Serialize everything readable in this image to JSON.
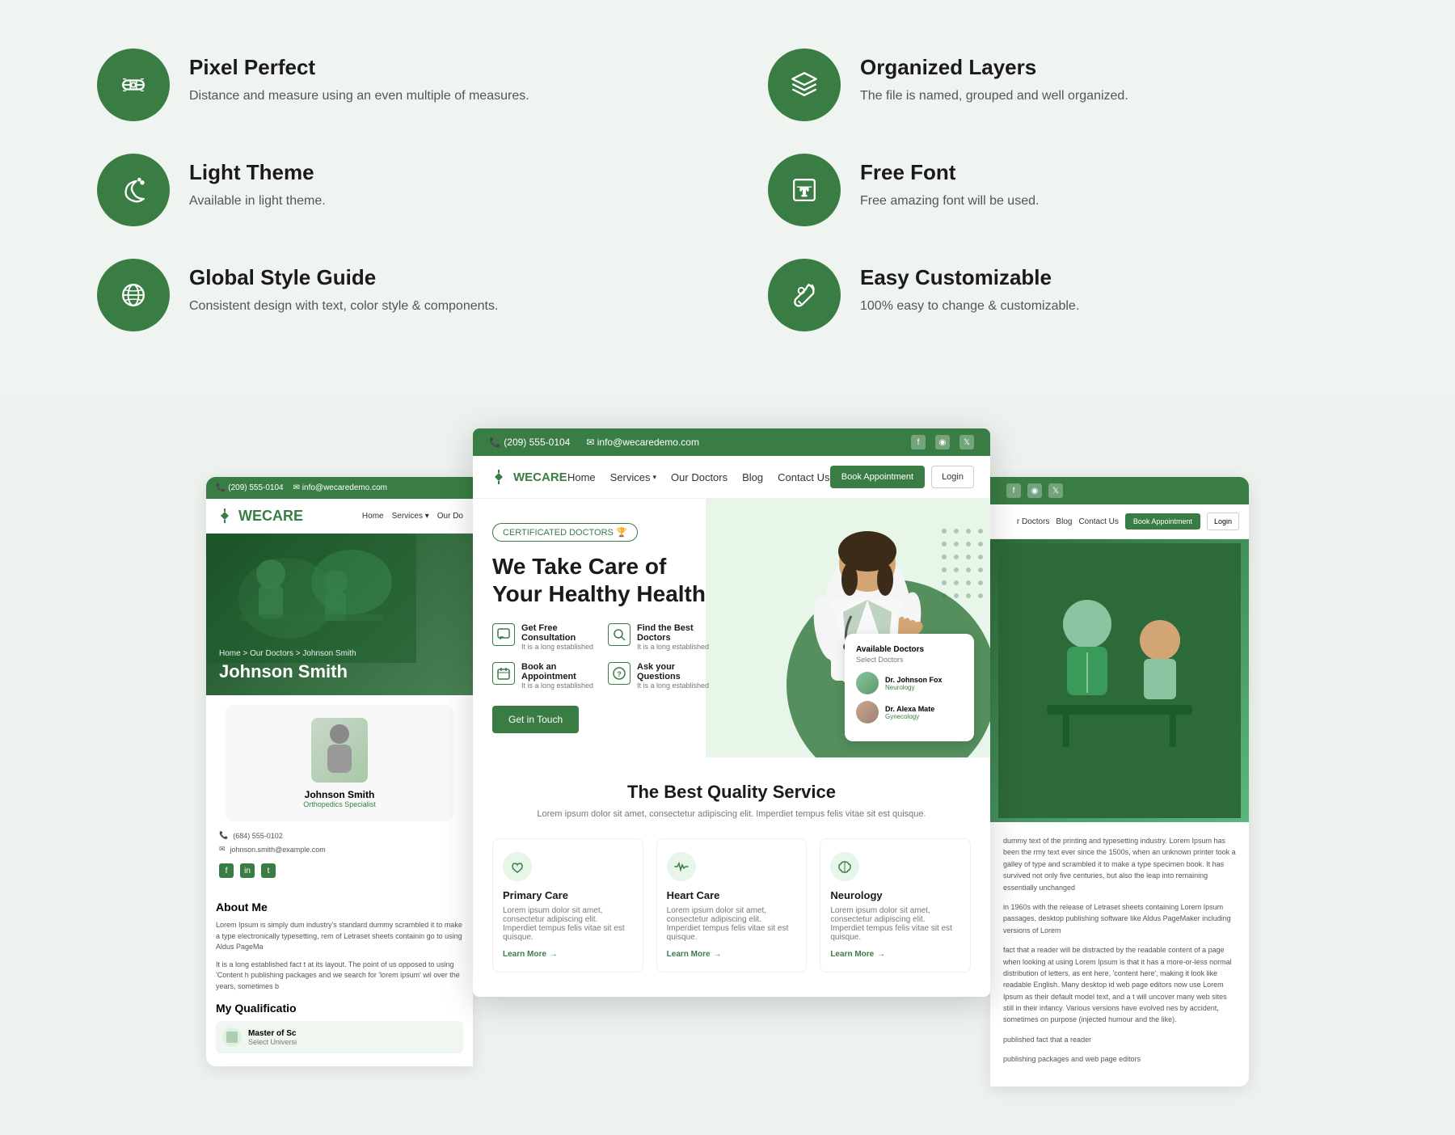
{
  "features": [
    {
      "id": "pixel-perfect",
      "title": "Pixel Perfect",
      "description": "Distance and measure using an even multiple of measures.",
      "icon": "bandage"
    },
    {
      "id": "organized-layers",
      "title": "Organized Layers",
      "description": "The file is named, grouped and well organized.",
      "icon": "layers"
    },
    {
      "id": "light-theme",
      "title": "Light Theme",
      "description": "Available in light theme.",
      "icon": "moon"
    },
    {
      "id": "free-font",
      "title": "Free Font",
      "description": "Free amazing font will be used.",
      "icon": "text"
    },
    {
      "id": "global-style",
      "title": "Global Style Guide",
      "description": "Consistent design with text, color style & components.",
      "icon": "globe"
    },
    {
      "id": "easy-custom",
      "title": "Easy Customizable",
      "description": "100% easy to change & customizable.",
      "icon": "wrench"
    }
  ],
  "topbar": {
    "phone": "(209) 555-0104",
    "email": "info@wecaredemo.com"
  },
  "nav": {
    "logo": "WECARE",
    "links": [
      "Home",
      "Services",
      "Our Doctors",
      "Blog",
      "Contact Us"
    ],
    "book_btn": "Book Appointment",
    "login_btn": "Login"
  },
  "hero": {
    "badge": "CERTIFICATED DOCTORS 🏆",
    "title_line1": "We Take Care of",
    "title_line2": "Your Healthy Health",
    "features": [
      {
        "title": "Get Free Consultation",
        "desc": "It is a long established"
      },
      {
        "title": "Find the Best Doctors",
        "desc": "It is a long established"
      },
      {
        "title": "Book an Appointment",
        "desc": "It is a long established"
      },
      {
        "title": "Ask your Questions",
        "desc": "It is a long established"
      }
    ],
    "cta": "Get in Touch",
    "doctor_card": {
      "title": "Available Doctors",
      "subtitle": "Select Doctors",
      "doctors": [
        {
          "name": "Dr. Johnson Fox",
          "specialty": "Neurology"
        },
        {
          "name": "Dr. Alexa Mate",
          "specialty": "Gynecology"
        }
      ]
    }
  },
  "services": {
    "title": "The Best Quality Service",
    "subtitle": "Lorem ipsum dolor sit amet, consectetur adipiscing elit. Imperdiet tempus felis vitae sit est quisque.",
    "items": [
      {
        "title": "Primary Care",
        "desc": "Lorem ipsum dolor sit amet, consectetur adipiscing elit. Imperdiet tempus felis vitae sit est quisque.",
        "learn_more": "Learn More"
      },
      {
        "title": "Heart Care",
        "desc": "Lorem ipsum dolor sit amet, consectetur adipiscing elit. Imperdiet tempus felis vitae sit est quisque.",
        "learn_more": "Learn More"
      },
      {
        "title": "Neurology",
        "desc": "Lorem ipsum dolor sit amet, consectetur adipiscing elit. Imperdiet tempus felis vitae sit est quisque.",
        "learn_more": "Learn More"
      }
    ]
  },
  "left_panel": {
    "doctor_name": "Johnson Smith",
    "breadcrumb": "Home > Our Doctors > Johnson Smith",
    "specialist": "Orthopedics Specialist",
    "phone": "(684) 555-0102",
    "email": "johnson.smith@example.com",
    "about_title": "About Me",
    "about_text": "Lorem Ipsum is simply dum industry's standard dummy scrambled it to make a type electronically typesetting, rem of Letraset sheets containin go to using Aldus PageMa",
    "about_text2": "It is a long established fact t at its layout. The point of us opposed to using 'Content h publishing packages and we search for 'lorem ipsum' wil over the years, sometimes b",
    "qualifications_title": "My Qualificatio",
    "qual_item": "Master of Sc",
    "qual_sub": "Select Universi"
  },
  "right_panel": {
    "paragraphs": [
      "dummy text of the printing and typesetting industry. Lorem Ipsum has been the rmy text ever since the 1500s, when an unknown printer took a galley of type and scrambled it to make a type specimen book. It has survived not only five centuries, but also the leap into remaining essentially unchanged",
      "in 1960s with the release of Letraset sheets containing Lorem Ipsum passages, desktop publishing software like Aldus PageMaker including versions of Lorem",
      "fact that a reader will be distracted by the readable content of a page when looking at using Lorem Ipsum is that it has a more-or-less normal distribution of letters, as ent here, 'content here', making it look like readable English. Many desktop id web page editors now use Lorem Ipsum as their default model text, and a t will uncover many web sites still in their infancy. Various versions have evolved nes by accident, sometimes on purpose (injected humour and the like).",
      "published fact that a reader",
      "publishing packages and web page editors"
    ]
  },
  "colors": {
    "primary_green": "#3a7d44",
    "light_green_bg": "#e8f5e9",
    "page_bg": "#f0f4f0"
  }
}
